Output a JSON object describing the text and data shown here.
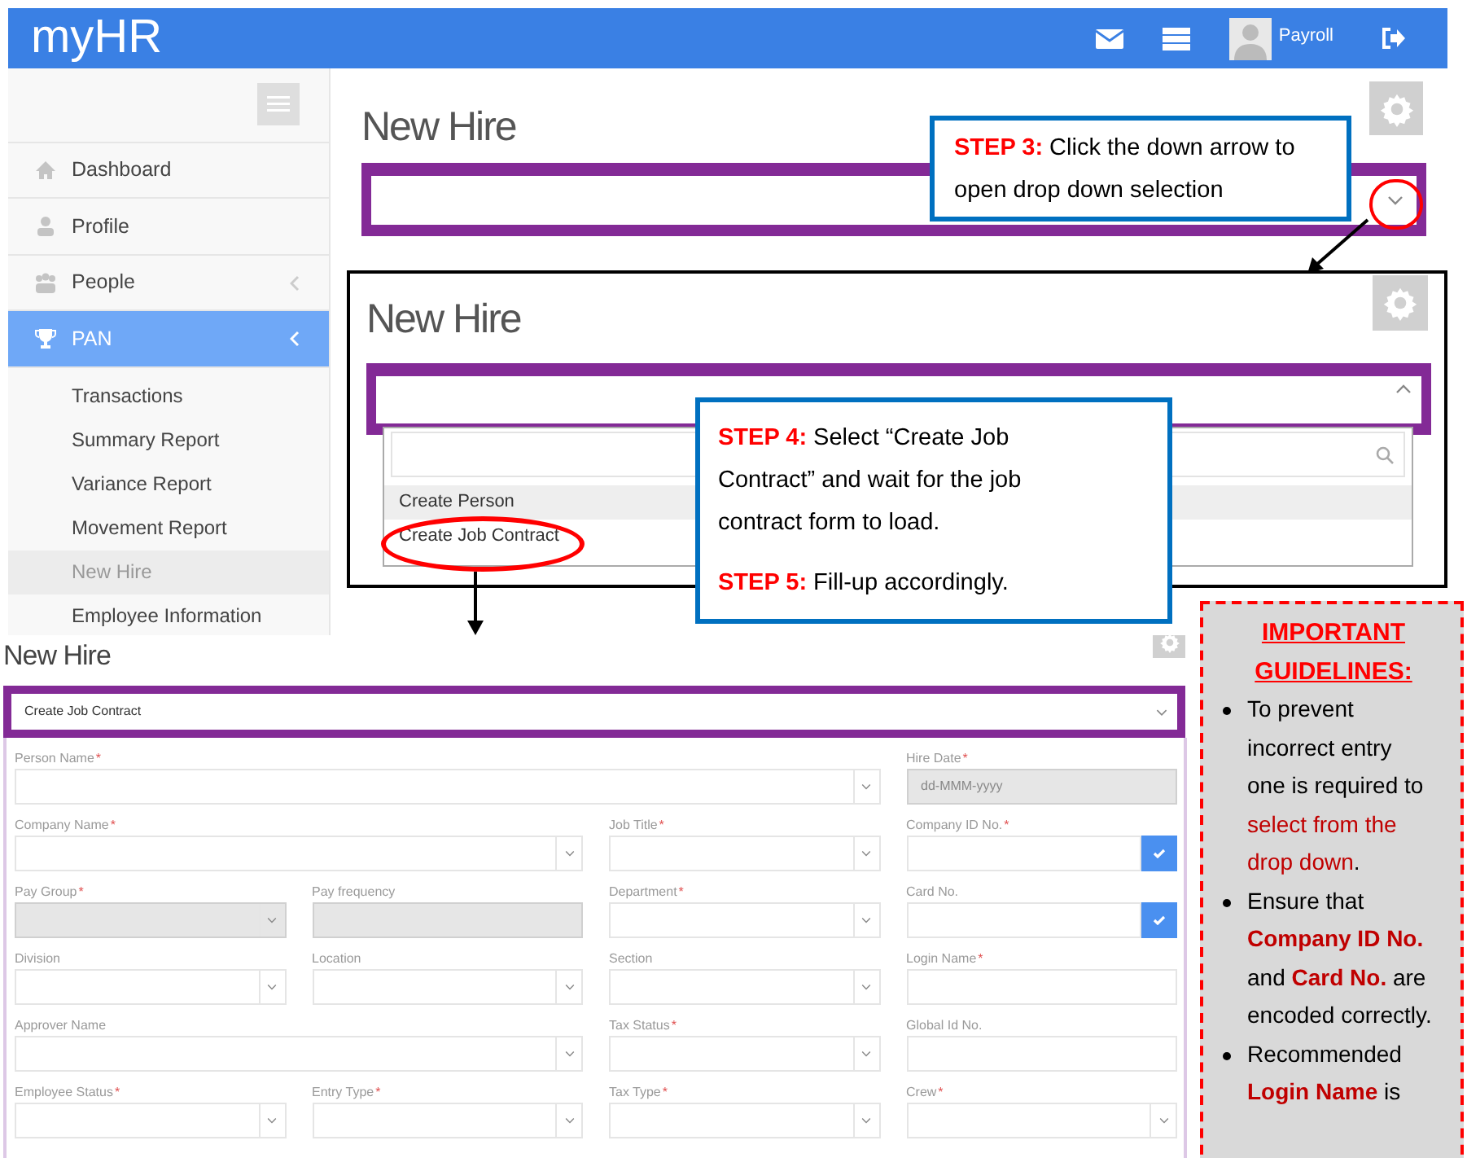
{
  "header": {
    "logo": "myHR",
    "user": "Payroll"
  },
  "sidebar": {
    "items": [
      {
        "label": "Dashboard",
        "selected": false,
        "kind": "link"
      },
      {
        "label": "Profile",
        "selected": false,
        "kind": "link"
      },
      {
        "label": "People",
        "selected": false,
        "kind": "group"
      },
      {
        "label": "PAN",
        "selected": true,
        "kind": "group",
        "children": [
          {
            "label": "Transactions",
            "selected": false
          },
          {
            "label": "Summary Report",
            "selected": false
          },
          {
            "label": "Variance Report",
            "selected": false
          },
          {
            "label": "Movement Report",
            "selected": false
          },
          {
            "label": "New Hire",
            "selected": true
          },
          {
            "label": "Employee Information",
            "selected": false
          }
        ]
      }
    ]
  },
  "screen_1": {
    "title": "New Hire"
  },
  "screen_2": {
    "title": "New Hire",
    "options": [
      {
        "label": "Create Person",
        "highlighted": true
      },
      {
        "label": "Create Job Contract",
        "highlighted": false
      }
    ]
  },
  "callouts": [
    {
      "paragraphs": [
        "**STEP 3:** Click the down arrow to open drop down selection"
      ]
    },
    {
      "paragraphs": [
        "**STEP 4:** Select “Create Job Contract” and wait for the job contract form to load.",
        "**STEP 5:** Fill-up accordingly."
      ]
    }
  ],
  "form_screen": {
    "title": "New Hire",
    "contract_type": "Create Job Contract",
    "fields": [
      {
        "label": "Person Name",
        "mark": "*",
        "kind": "longest-select",
        "disabled": false
      },
      {
        "label": "Hire Date",
        "mark": "*",
        "kind": "date",
        "placeholder": "dd-MMM-yyyy",
        "disabled": true
      },
      {
        "label": "Company Name",
        "mark": "*",
        "kind": "long-select",
        "disabled": false
      },
      {
        "label": "Job Title",
        "mark": "*",
        "kind": "select",
        "disabled": false
      },
      {
        "label": "Company ID No.",
        "mark": "*",
        "kind": "verify-input",
        "disabled": false
      },
      {
        "label": "Pay Group",
        "mark": "*",
        "kind": "select",
        "disabled": true
      },
      {
        "label": "Pay frequency",
        "kind": "input",
        "disabled": true
      },
      {
        "label": "Department",
        "mark": "*",
        "kind": "select",
        "disabled": false
      },
      {
        "label": "Card No.",
        "kind": "verify-input",
        "disabled": false
      },
      {
        "label": "Division",
        "kind": "select",
        "disabled": false
      },
      {
        "label": "Location",
        "kind": "select",
        "disabled": false
      },
      {
        "label": "Section",
        "kind": "select",
        "disabled": false
      },
      {
        "label": "Login Name",
        "mark": "*",
        "kind": "input",
        "disabled": false
      },
      {
        "label": "Approver Name",
        "kind": "long-select",
        "disabled": false
      },
      {
        "label": "Tax Status",
        "mark": "*",
        "kind": "select",
        "disabled": false
      },
      {
        "label": "Global Id No.",
        "kind": "input",
        "disabled": false
      },
      {
        "label": "Employee Status",
        "mark": "*",
        "kind": "select",
        "disabled": false
      },
      {
        "label": "Entry Type",
        "mark": "*",
        "kind": "select",
        "disabled": false
      },
      {
        "label": "Tax Type",
        "mark": "*",
        "kind": "select",
        "disabled": false
      },
      {
        "label": "Crew",
        "mark": "*",
        "kind": "select",
        "disabled": false
      }
    ]
  },
  "guidelines": {
    "title": "IMPORTANT GUIDELINES:",
    "bullets": [
      [
        {
          "text": "To prevent incorrect entry one is required to ",
          "kind": "plain"
        },
        {
          "text": "select from the drop down",
          "kind": "highlight"
        },
        {
          "text": ".",
          "kind": "plain"
        }
      ],
      [
        {
          "text": "Ensure that ",
          "kind": "plain"
        },
        {
          "text": "Company ID No.",
          "kind": "emphasis"
        },
        {
          "text": " and ",
          "kind": "plain"
        },
        {
          "text": "Card No.",
          "kind": "emphasis"
        },
        {
          "text": " are encoded correctly.",
          "kind": "plain"
        }
      ],
      [
        {
          "text": "Recommended ",
          "kind": "plain"
        },
        {
          "text": "Login Name",
          "kind": "emphasis"
        },
        {
          "text": " is",
          "kind": "plain"
        }
      ]
    ]
  }
}
